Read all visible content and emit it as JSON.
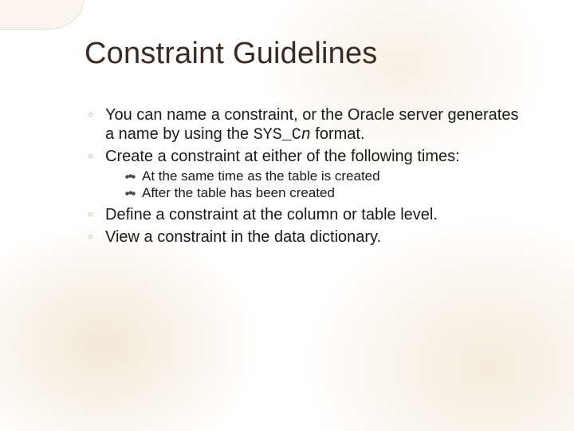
{
  "title": "Constraint Guidelines",
  "bullets": {
    "b1_pre": "You can name a constraint, or the Oracle server generates a name by using the ",
    "b1_code": "SYS_C",
    "b1_code_ital": "n",
    "b1_post": " format.",
    "b2": "Create a constraint at either of the following times:",
    "b2_sub1": "At the same time as the table is created",
    "b2_sub2": "After the table has been created",
    "b3": "Define a constraint at the column or table level.",
    "b4": "View a constraint in the data dictionary."
  }
}
